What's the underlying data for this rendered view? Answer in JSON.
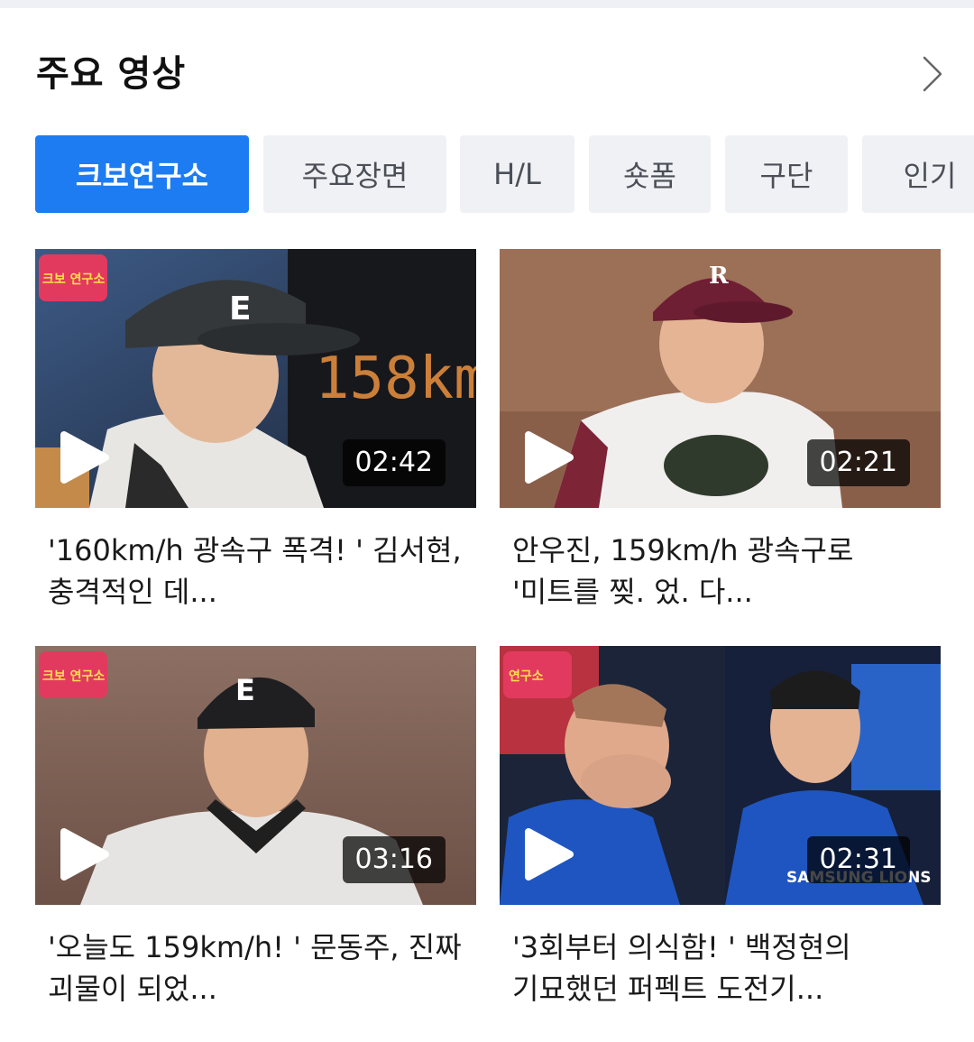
{
  "section": {
    "title": "주요 영상"
  },
  "tabs": [
    {
      "label": "크보연구소",
      "active": true
    },
    {
      "label": "주요장면",
      "active": false
    },
    {
      "label": "H/L",
      "active": false
    },
    {
      "label": "숏폼",
      "active": false
    },
    {
      "label": "구단",
      "active": false
    },
    {
      "label": "인기",
      "active": false
    }
  ],
  "videos": [
    {
      "title": "'160km/h 광속구 폭격! ' 김서현, 충격적인 데...",
      "duration": "02:42",
      "thumb_text": "158km",
      "badge_text": "크보 연구소"
    },
    {
      "title": "안우진, 159km/h 광속구로 '미트를 찢. 었. 다...",
      "duration": "02:21",
      "thumb_text": "",
      "badge_text": ""
    },
    {
      "title": "'오늘도 159km/h! ' 문동주, 진짜 괴물이 되었...",
      "duration": "03:16",
      "thumb_text": "",
      "badge_text": "크보 연구소"
    },
    {
      "title": "'3회부터 의식함! ' 백정현의 기묘했던 퍼펙트 도전기...",
      "duration": "02:31",
      "thumb_text": "SAMSUNG LIONS",
      "badge_text": "연구소"
    }
  ],
  "colors": {
    "accent": "#1d7cf2",
    "tab_bg": "#f0f1f4",
    "tab_text": "#4b4f57"
  }
}
